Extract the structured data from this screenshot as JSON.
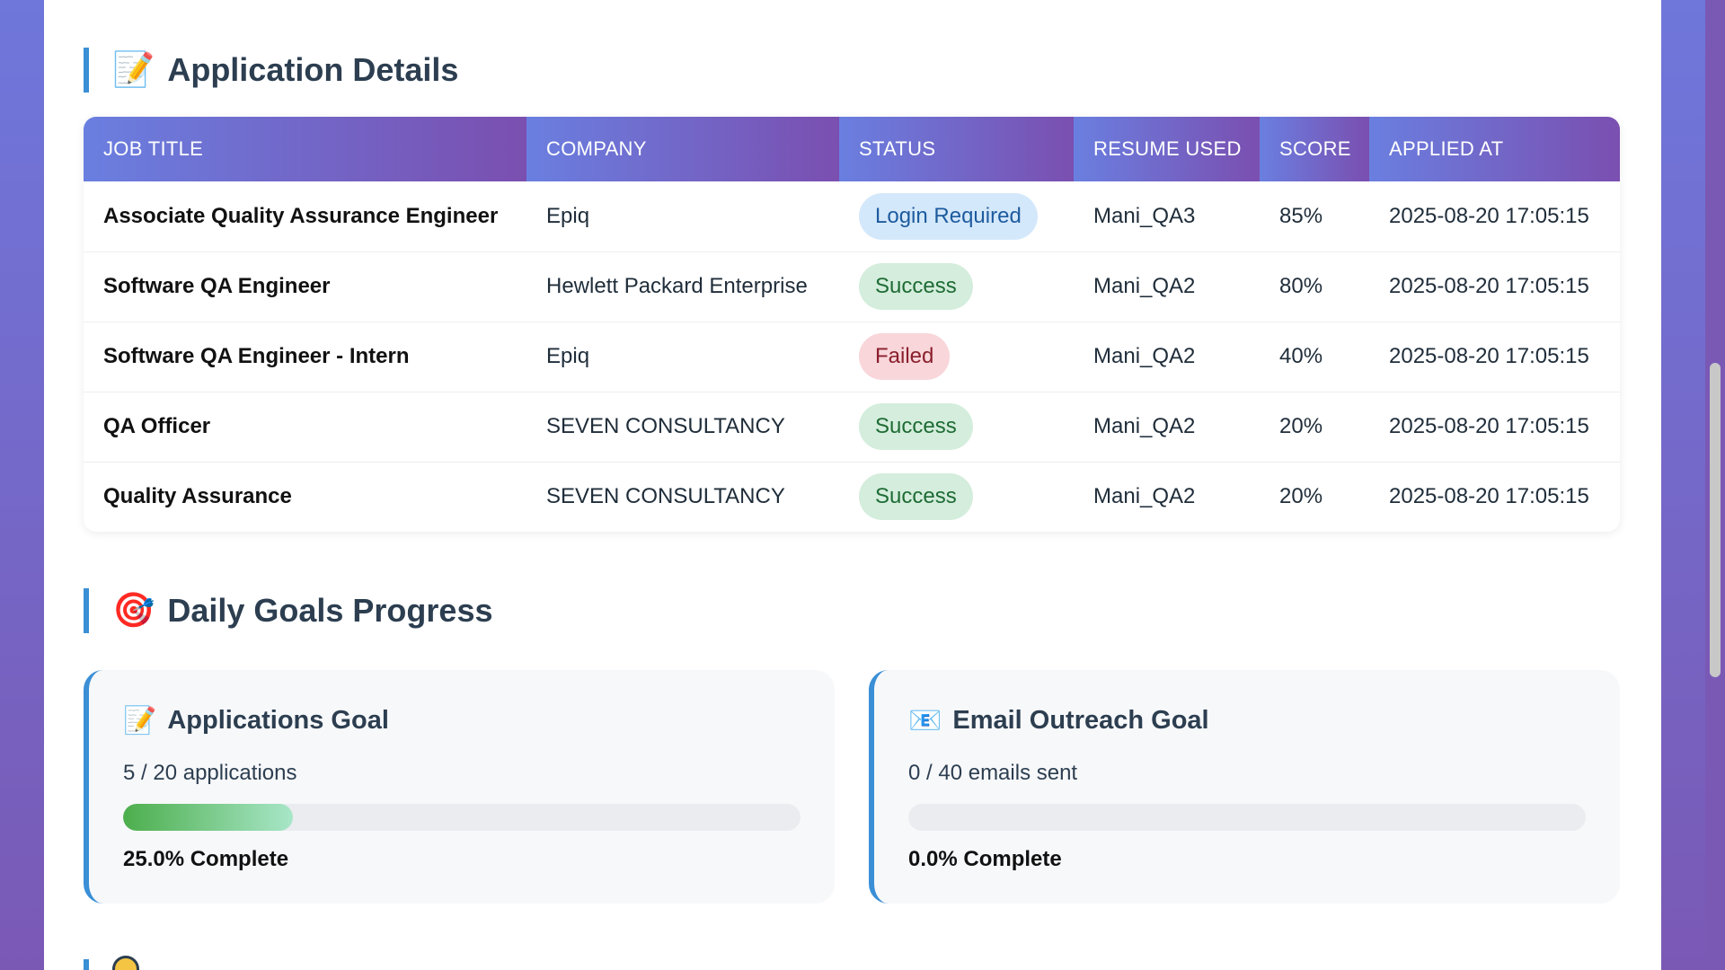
{
  "application_details": {
    "icon": "memo-icon",
    "title": "Application Details",
    "columns": [
      "JOB TITLE",
      "COMPANY",
      "STATUS",
      "RESUME USED",
      "SCORE",
      "APPLIED AT"
    ],
    "rows": [
      {
        "job": "Associate Quality Assurance Engineer",
        "company": "Epiq",
        "status": "Login Required",
        "status_type": "login",
        "resume": "Mani_QA3",
        "score": "85%",
        "applied": "2025-08-20 17:05:15"
      },
      {
        "job": "Software QA Engineer",
        "company": "Hewlett Packard Enterprise",
        "status": "Success",
        "status_type": "success",
        "resume": "Mani_QA2",
        "score": "80%",
        "applied": "2025-08-20 17:05:15"
      },
      {
        "job": "Software QA Engineer - Intern",
        "company": "Epiq",
        "status": "Failed",
        "status_type": "failed",
        "resume": "Mani_QA2",
        "score": "40%",
        "applied": "2025-08-20 17:05:15"
      },
      {
        "job": "QA Officer",
        "company": "SEVEN CONSULTANCY",
        "status": "Success",
        "status_type": "success",
        "resume": "Mani_QA2",
        "score": "20%",
        "applied": "2025-08-20 17:05:15"
      },
      {
        "job": "Quality Assurance",
        "company": "SEVEN CONSULTANCY",
        "status": "Success",
        "status_type": "success",
        "resume": "Mani_QA2",
        "score": "20%",
        "applied": "2025-08-20 17:05:15"
      }
    ]
  },
  "daily_goals": {
    "icon": "target-icon",
    "title": "Daily Goals Progress",
    "cards": [
      {
        "icon": "memo-icon",
        "title": "Applications Goal",
        "count": "5 / 20 applications",
        "progress": 0.25,
        "complete": "25.0% Complete"
      },
      {
        "icon": "envelope-icon",
        "title": "Email Outreach Goal",
        "count": "0 / 40 emails sent",
        "progress": 0.0,
        "complete": "0.0% Complete"
      }
    ]
  },
  "colors": {
    "accent": "#3a8fd6",
    "header_gradient_start": "#6a7fe0",
    "header_gradient_end": "#7a4fb0",
    "progress_start": "#4cae4c",
    "progress_end": "#a8e6c8"
  }
}
